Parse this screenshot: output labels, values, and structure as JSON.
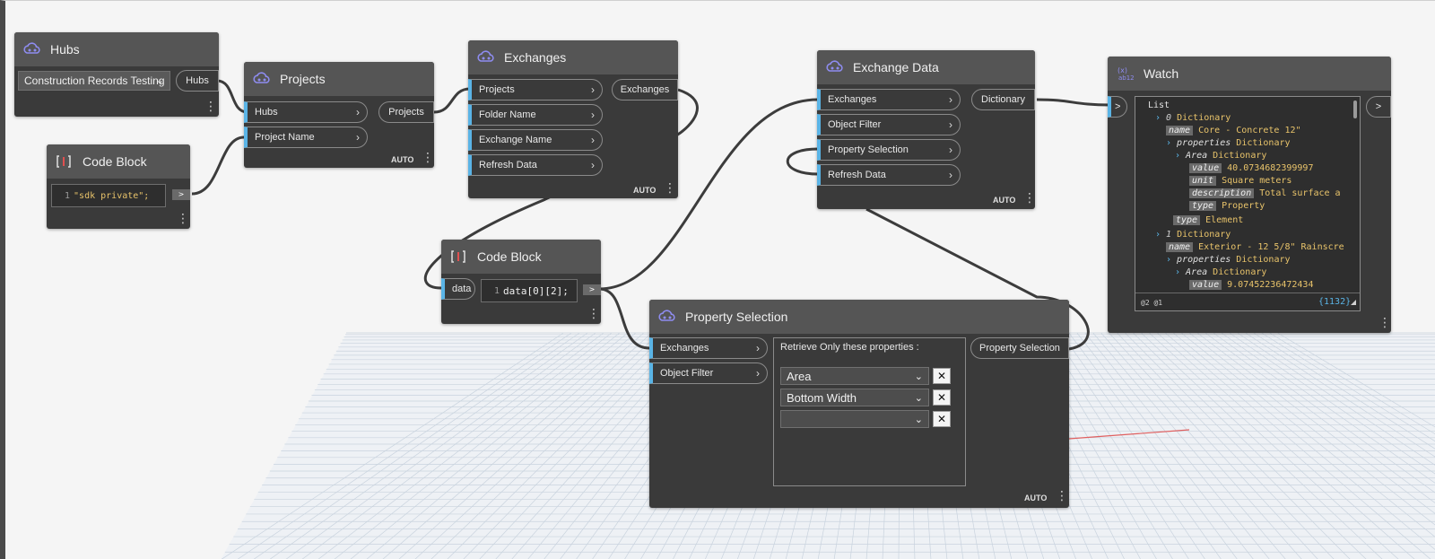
{
  "colors": {
    "accent": "#5ab4e6",
    "node_bg": "#3a3a3a",
    "header_bg": "#555555",
    "value_gold": "#e8c36a"
  },
  "icons": {
    "cloud": "cloud-hub-icon",
    "code": "code-block-icon",
    "watch": "watch-icon"
  },
  "hubs": {
    "title": "Hubs",
    "dropdown_value": "Construction Records Testing",
    "output": "Hubs"
  },
  "code_block_1": {
    "title": "Code Block",
    "line_no": "1",
    "code": "\"sdk private\";",
    "output": ">"
  },
  "projects": {
    "title": "Projects",
    "inputs": [
      "Hubs",
      "Project Name"
    ],
    "output": "Projects",
    "lacing": "AUTO"
  },
  "exchanges": {
    "title": "Exchanges",
    "inputs": [
      "Projects",
      "Folder Name",
      "Exchange Name",
      "Refresh Data"
    ],
    "output": "Exchanges",
    "lacing": "AUTO"
  },
  "code_block_2": {
    "title": "Code Block",
    "input": "data",
    "line_no": "1",
    "code": "data[0][2];",
    "output": ">"
  },
  "exchange_data": {
    "title": "Exchange Data",
    "inputs": [
      "Exchanges",
      "Object Filter",
      "Property Selection",
      "Refresh Data"
    ],
    "output": "Dictionary",
    "lacing": "AUTO"
  },
  "property_selection": {
    "title": "Property Selection",
    "inputs": [
      "Exchanges",
      "Object Filter"
    ],
    "panel_label": "Retrieve Only these properties :",
    "selections": [
      "Area",
      "Bottom Width",
      ""
    ],
    "remove_label": "✕",
    "output": "Property Selection",
    "lacing": "AUTO"
  },
  "watch": {
    "title": "Watch",
    "input": ">",
    "output": ">",
    "footer_levels": "@2 @1",
    "footer_count": "{1132}",
    "lines": {
      "l0": "List",
      "l1_idx": "0",
      "l1_type": "Dictionary",
      "l2_key": "name",
      "l2_val": "Core - Concrete 12\"",
      "l3_key": "properties",
      "l3_type": "Dictionary",
      "l4_key": "Area",
      "l4_type": "Dictionary",
      "l5_key": "value",
      "l5_val": "40.0734682399997",
      "l6_key": "unit",
      "l6_val": "Square meters",
      "l7_key": "description",
      "l7_val": "Total surface a",
      "l8_key": "type",
      "l8_val": "Property",
      "l9_key": "type",
      "l9_val": "Element",
      "l10_idx": "1",
      "l10_type": "Dictionary",
      "l11_key": "name",
      "l11_val": "Exterior - 12 5/8\" Rainscre",
      "l12_key": "properties",
      "l12_type": "Dictionary",
      "l13_key": "Area",
      "l13_type": "Dictionary",
      "l14_key": "value",
      "l14_val": "9.07452236472434"
    }
  }
}
